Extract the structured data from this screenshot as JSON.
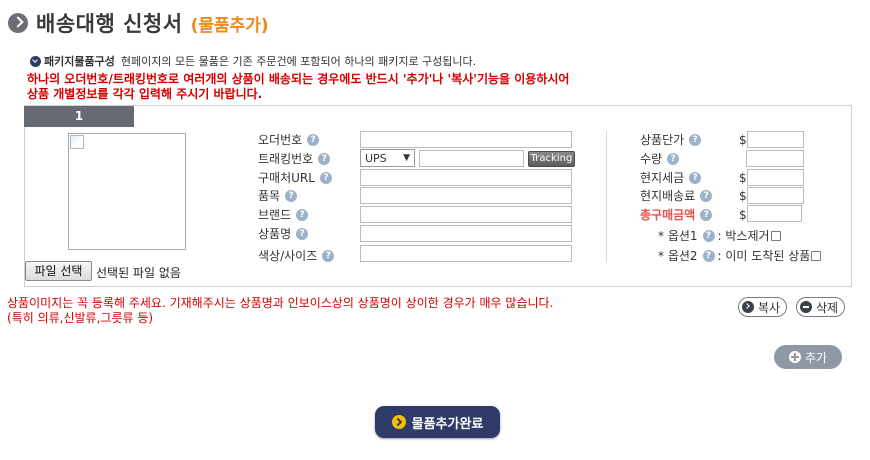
{
  "header": {
    "title": "배송대행 신청서",
    "subtitle": "(물품추가)"
  },
  "info": {
    "label": "패키지물품구성",
    "text": "현페이지의 모든 물품은 기존 주문건에 포함되어 하나의 패키지로 구성됩니다."
  },
  "warning": {
    "line1": "하나의 오더번호/트래킹번호로 여러개의 상품이 배송되는 경우에도 반드시 '추가'나 '복사'기능을 이용하시어",
    "line2": "상품 개별정보를 각각 입력해 주시기 바랍니다."
  },
  "product": {
    "tab_number": "1",
    "file_button": "파일 선택",
    "file_status": "선택된 파일 없음",
    "fields": {
      "order_number": "오더번호",
      "tracking_number": "트래킹번호",
      "purchase_url": "구매처URL",
      "item": "품목",
      "brand": "브랜드",
      "product_name": "상품명",
      "color_size": "색상/사이즈"
    },
    "carrier": "UPS",
    "tracking_button": "Tracking",
    "price_fields": {
      "unit_price": "상품단가",
      "quantity": "수량",
      "local_tax": "현지세금",
      "local_shipping": "현지배송료",
      "total": "총구매금액"
    },
    "currency": "$",
    "options": {
      "option1_label": "* 옵션1",
      "option1_text": ": 박스제거",
      "option2_label": "* 옵션2",
      "option2_text": ": 이미 도착된 상품"
    }
  },
  "notice": {
    "line1": "상품이미지는 꼭 등록해 주세요. 기재해주시는 상품명과 인보이스상의 상품명이 상이한 경우가 매우 많습니다.",
    "line2": "(특히 의류,신발류,그릇류 등)"
  },
  "buttons": {
    "copy": "복사",
    "delete": "삭제",
    "add": "추가",
    "complete": "물품추가완료"
  },
  "icons": {
    "title": "circle-arrow-icon",
    "info": "circle-check-icon",
    "help": "question-icon",
    "add": "plus-icon"
  },
  "colors": {
    "accent_orange": "#f0891a",
    "warning_red": "#d40000",
    "navy": "#2e3a68",
    "tab_gray": "#666b73"
  }
}
